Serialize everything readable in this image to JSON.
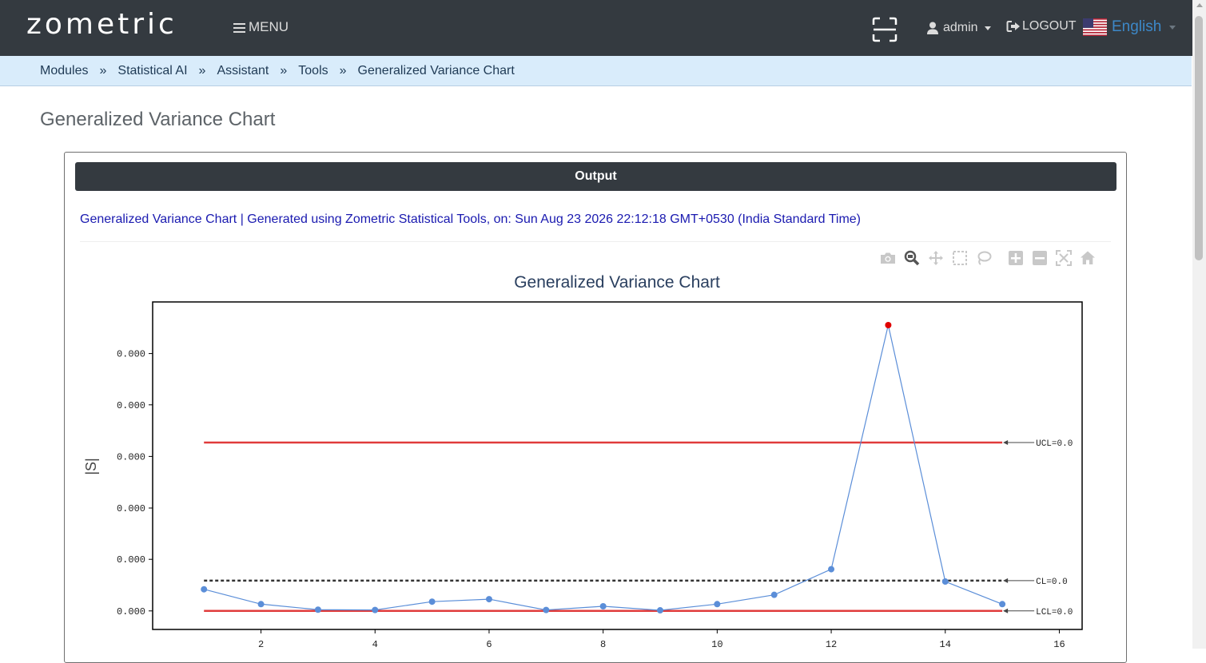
{
  "header": {
    "logo": "zometric",
    "menu_label": "MENU",
    "user_label": "admin",
    "logout_label": "LOGOUT",
    "language_label": "English"
  },
  "breadcrumb": {
    "items": [
      "Modules",
      "Statistical AI",
      "Assistant",
      "Tools",
      "Generalized Variance Chart"
    ],
    "separator": "»"
  },
  "page_title": "Generalized Variance Chart",
  "output": {
    "bar_label": "Output",
    "note": "Generalized Variance Chart | Generated using Zometric Statistical Tools, on: Sun Aug 23 2026 22:12:18 GMT+0530 (India Standard Time)"
  },
  "modebar_icons": [
    "camera-icon",
    "zoom-icon",
    "pan-icon",
    "box-select-icon",
    "lasso-select-icon",
    "zoom-in-icon",
    "zoom-out-icon",
    "autoscale-icon",
    "reset-axes-icon"
  ],
  "colors": {
    "topbar": "#343a40",
    "breadcrumb_bg": "#d9ecfb",
    "series": "#5b8ed8",
    "limit": "#e03b3b",
    "out_of_control": "#e00000",
    "center": "#333333",
    "link": "#3d88c8"
  },
  "chart_data": {
    "type": "line",
    "title": "Generalized Variance Chart",
    "ylabel": "|S|",
    "xlabel": "",
    "xlim": [
      0.1,
      16.4
    ],
    "ylim": [
      -0.06,
      1.0
    ],
    "x_ticks": [
      2,
      4,
      6,
      8,
      10,
      12,
      14,
      16
    ],
    "y_ticks": [
      0,
      0.167,
      0.333,
      0.5,
      0.667,
      0.833
    ],
    "y_tick_labels": [
      "0.000",
      "0.000",
      "0.000",
      "0.000",
      "0.000",
      "0.000"
    ],
    "series": [
      {
        "x": [
          1,
          2,
          3,
          4,
          5,
          6,
          7,
          8,
          9,
          10,
          11,
          12,
          13,
          14,
          15
        ],
        "values": [
          0.07,
          0.022,
          0.004,
          0.003,
          0.03,
          0.038,
          0.003,
          0.015,
          0.002,
          0.022,
          0.052,
          0.135,
          0.925,
          0.095,
          0.022
        ],
        "out_of_control": [
          13
        ]
      }
    ],
    "control_lines": [
      {
        "label": "UCL=0.0",
        "value": 0.545,
        "x": [
          1,
          15
        ],
        "style": "solid-red"
      },
      {
        "label": "CL=0.0",
        "value": 0.098,
        "x": [
          1,
          15
        ],
        "style": "dotted-black"
      },
      {
        "label": "LCL=0.0",
        "value": 0.0,
        "x": [
          1,
          15
        ],
        "style": "solid-red"
      }
    ],
    "grid": false
  }
}
